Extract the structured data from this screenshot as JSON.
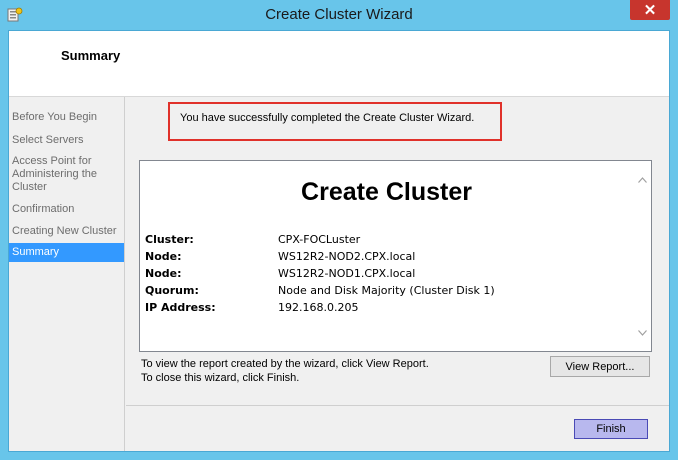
{
  "window": {
    "title": "Create Cluster Wizard",
    "close_symbol": "✕",
    "accent_color": "#68c5ea"
  },
  "header": {
    "title": "Summary"
  },
  "nav": {
    "items": [
      {
        "label": "Before You Begin",
        "active": false
      },
      {
        "label": "Select Servers",
        "active": false
      },
      {
        "label": "Access Point for Administering the Cluster",
        "active": false
      },
      {
        "label": "Confirmation",
        "active": false
      },
      {
        "label": "Creating New Cluster",
        "active": false
      },
      {
        "label": "Summary",
        "active": true
      }
    ]
  },
  "main": {
    "success_message": "You have successfully completed the Create Cluster Wizard.",
    "report": {
      "heading": "Create Cluster",
      "rows": [
        {
          "label": "Cluster:",
          "value": "CPX-FOCLuster"
        },
        {
          "label": "Node:",
          "value": "WS12R2-NOD2.CPX.local"
        },
        {
          "label": "Node:",
          "value": "WS12R2-NOD1.CPX.local"
        },
        {
          "label": "Quorum:",
          "value": "Node and Disk Majority (Cluster Disk 1)"
        },
        {
          "label": "IP Address:",
          "value": "192.168.0.205"
        }
      ]
    },
    "hint_view_report": "To view the report created by the wizard, click View Report.",
    "hint_close": "To close this wizard, click Finish.",
    "view_report_label": "View Report..."
  },
  "footer": {
    "finish_label": "Finish"
  }
}
